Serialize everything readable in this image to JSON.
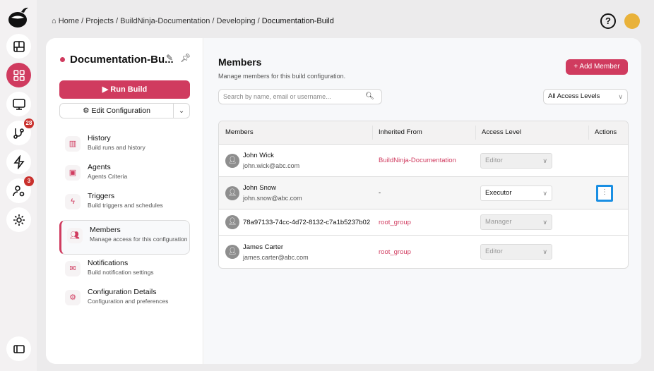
{
  "breadcrumb": [
    "Home",
    "Projects",
    "BuildNinja-Documentation",
    "Developing",
    "Documentation-Build"
  ],
  "rail": {
    "badges": {
      "pipelines": "28",
      "users": "3"
    },
    "accent": "#d03b5f"
  },
  "config": {
    "title": "Documentation-Bu...",
    "run_label": "Run Build",
    "edit_label": "Edit Configuration"
  },
  "nav": [
    {
      "title": "History",
      "sub": "Build runs and history",
      "icon": "chart-icon"
    },
    {
      "title": "Agents",
      "sub": "Agents Criteria",
      "icon": "agent-icon"
    },
    {
      "title": "Triggers",
      "sub": "Build triggers and schedules",
      "icon": "lightning-icon"
    },
    {
      "title": "Members",
      "sub": "Manage access for this configuration",
      "icon": "users-icon"
    },
    {
      "title": "Notifications",
      "sub": "Build notification settings",
      "icon": "mail-icon"
    },
    {
      "title": "Configuration Details",
      "sub": "Configuration and preferences",
      "icon": "gear-icon"
    }
  ],
  "members": {
    "title": "Members",
    "subtitle": "Manage members for this build configuration.",
    "add_label": "+ Add Member",
    "search_placeholder": "Search by name, email or username...",
    "filter": "All Access Levels",
    "columns": [
      "Members",
      "Inherited From",
      "Access Level",
      "Actions"
    ],
    "rows": [
      {
        "name": "John Wick",
        "email": "john.wick@abc.com",
        "inherited": "BuildNinja-Documentation",
        "access": "Editor"
      },
      {
        "name": "John Snow",
        "email": "john.snow@abc.com",
        "inherited": "-",
        "access": "Executor"
      },
      {
        "name": "78a97133-74cc-4d72-8132-c7a1b5237b02",
        "email": "",
        "inherited": "root_group",
        "access": "Manager"
      },
      {
        "name": "James Carter",
        "email": "james.carter@abc.com",
        "inherited": "root_group",
        "access": "Editor"
      }
    ]
  }
}
